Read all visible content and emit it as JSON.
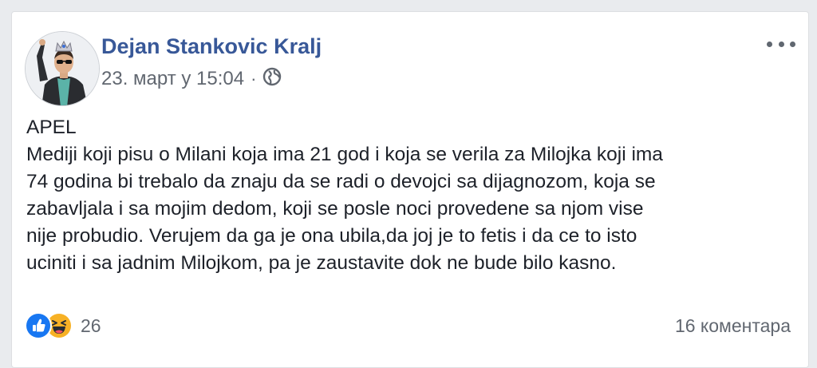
{
  "post": {
    "author": "Dejan Stankovic Kralj",
    "date": "23. март у 15:04",
    "separator": "·",
    "privacy_icon": "globe-icon",
    "more_icon": "more-options-icon",
    "text_lines": [
      "APEL",
      "Mediji koji pisu o Milani koja ima 21 god i koja se verila za Milojka koji ima",
      "74 godina bi trebalo da znaju da se radi o devojci sa dijagnozom, koja se",
      "zabavljala i sa mojim dedom, koji se posle noci provedene sa njom vise",
      "nije probudio. Verujem da ga je ona ubila,da joj je to fetis i da ce to isto",
      "uciniti i sa jadnim Milojkom, pa je zaustavite dok ne bude bilo kasno."
    ],
    "reactions": {
      "icons": [
        "like-icon",
        "haha-icon"
      ],
      "count": "26"
    },
    "comments_label": "16 коментара",
    "colors": {
      "author_link": "#385898",
      "meta_text": "#616770",
      "body_text": "#1d2129",
      "like_blue": "#1877f2",
      "haha_yellow": "#f7b125",
      "page_bg": "#e9ebee"
    }
  }
}
